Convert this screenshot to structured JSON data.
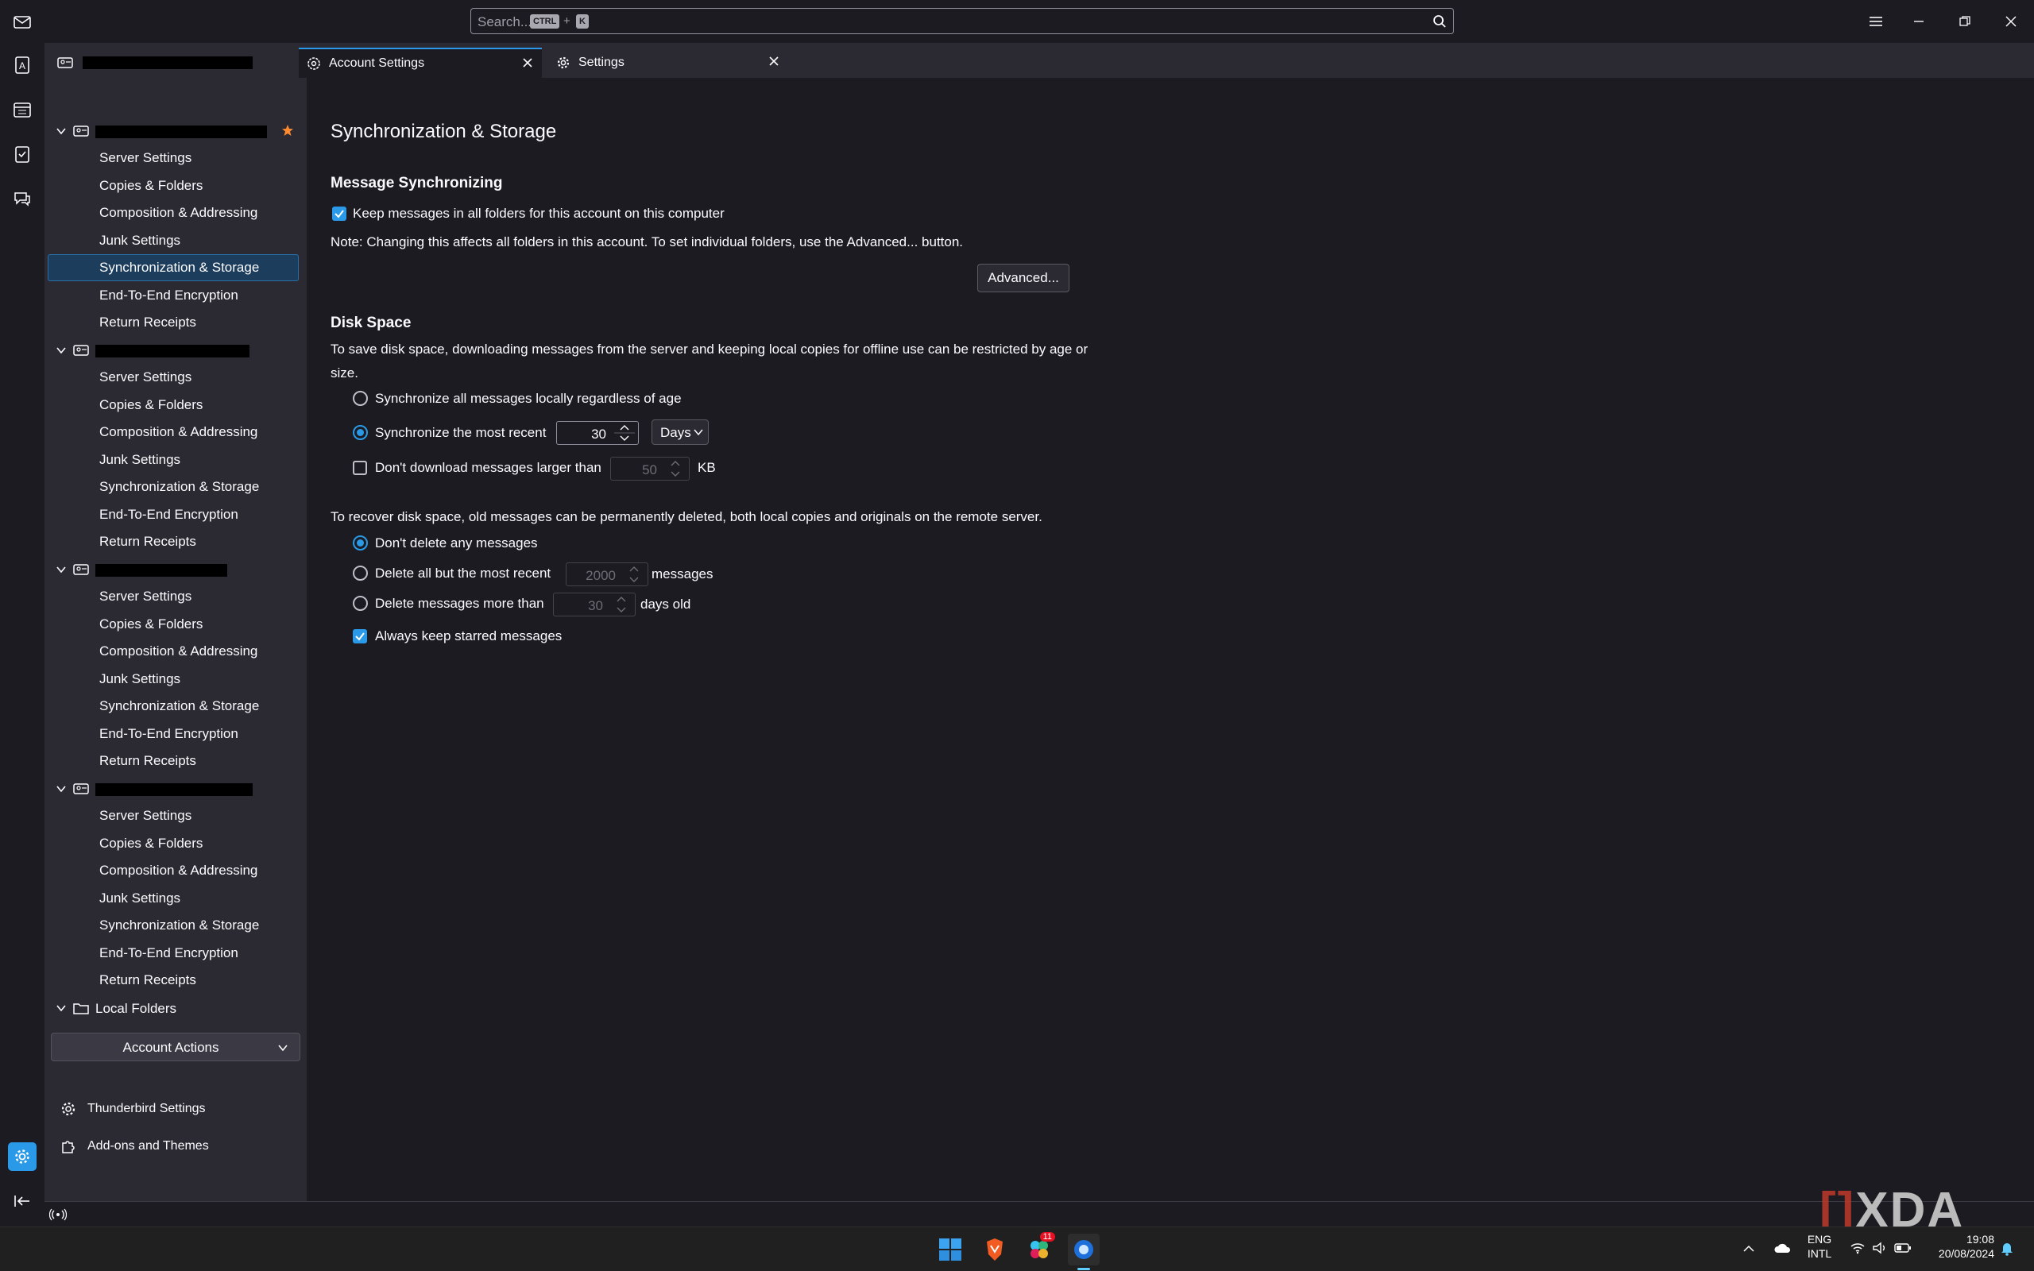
{
  "search": {
    "placeholder": "Search...",
    "shortcut_key1": "CTRL",
    "shortcut_plus": "+",
    "shortcut_key2": "K"
  },
  "tabs": [
    {
      "label": "",
      "icon": "account-icon"
    },
    {
      "label": "Account Settings",
      "icon": "account-settings-icon"
    },
    {
      "label": "Settings",
      "icon": "gear-icon"
    }
  ],
  "sidebar": {
    "account_items": [
      "Server Settings",
      "Copies & Folders",
      "Composition & Addressing",
      "Junk Settings",
      "Synchronization & Storage",
      "End-To-End Encryption",
      "Return Receipts"
    ],
    "local_folders": "Local Folders",
    "account_actions": "Account Actions",
    "thunderbird_settings": "Thunderbird Settings",
    "addons": "Add-ons and Themes",
    "selected": "Synchronization & Storage"
  },
  "main": {
    "title": "Synchronization & Storage",
    "msg_sync_heading": "Message Synchronizing",
    "keep_messages_label": "Keep messages in all folders for this account on this computer",
    "keep_messages_checked": true,
    "note": "Note: Changing this affects all folders in this account. To set individual folders, use the Advanced... button.",
    "advanced_button": "Advanced...",
    "disk_heading": "Disk Space",
    "disk_desc_line1": "To save disk space, downloading messages from the server and keeping local copies for offline use can be restricted by age or",
    "disk_desc_line2": "size.",
    "sync_all_label": "Synchronize all messages locally regardless of age",
    "sync_recent_label": "Synchronize the most recent",
    "sync_recent_value": "30",
    "sync_recent_unit": "Days",
    "dont_download_label": "Don't download messages larger than",
    "dont_download_value": "50",
    "dont_download_unit": "KB",
    "recover_desc": "To recover disk space, old messages can be permanently deleted, both local copies and originals on the remote server.",
    "dont_delete_label": "Don't delete any messages",
    "delete_all_but_label": "Delete all but the most recent",
    "delete_all_but_value": "2000",
    "delete_all_but_unit": "messages",
    "delete_older_label": "Delete messages more than",
    "delete_older_value": "30",
    "delete_older_unit": "days old",
    "keep_starred_label": "Always keep starred messages",
    "keep_starred_checked": true
  },
  "taskbar": {
    "lang_line1": "ENG",
    "lang_line2": "INTL",
    "time": "19:08",
    "date": "20/08/2024",
    "badge": "11"
  },
  "watermark": "XDA",
  "colors": {
    "accent": "#2a9ae8",
    "sidebar_bg": "#2b2a33",
    "main_bg": "#1c1b22",
    "star": "#ff8a30"
  }
}
